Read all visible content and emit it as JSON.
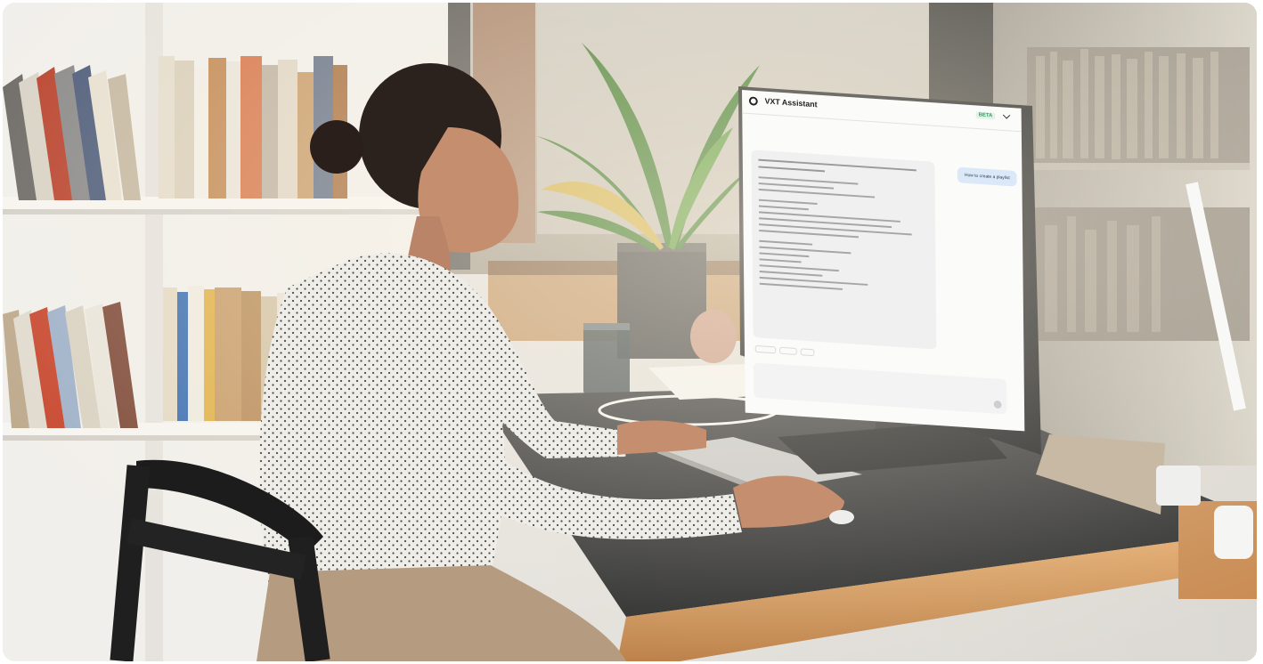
{
  "photo": {
    "description_free": true
  },
  "monitor_ui": {
    "app_title": "VXT Assistant",
    "badge": "BETA",
    "menu_icon": "chevron-down-icon",
    "logo_icon": "assistant-logo-icon",
    "user_bubble": "How to create a playlist",
    "answer_lines": 20,
    "suggestion_count": 3,
    "send_icon": "send-icon"
  },
  "colors": {
    "accent_badge": "#2e9c5e",
    "user_bubble": "#dbe8f7",
    "answer_bubble": "#f0f0f0"
  }
}
